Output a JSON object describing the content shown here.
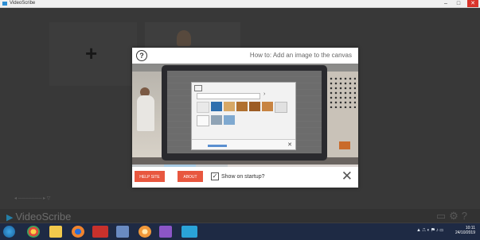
{
  "window": {
    "title": "VideoScribe",
    "minimize": "–",
    "maximize": "□",
    "close": "✕"
  },
  "background": {
    "new_canvas_symbol": "+",
    "logo_text": "VideoScribe",
    "logo_icon": "play-triangle-icon",
    "bottom_icons": [
      "folder-icon",
      "gear-icon",
      "help-icon"
    ]
  },
  "modal": {
    "help_icon": "?",
    "title": "How to: Add an image to the canvas",
    "buttons": {
      "help": "HELP SITE",
      "about": "ABOUT"
    },
    "startup_label": "Show on startup?",
    "startup_checked": true,
    "check_mark": "✓",
    "close_symbol": "✕",
    "timeline_marker": "◆"
  },
  "colors": {
    "accent": "#e8573f",
    "taskbar": "#1e2a44",
    "modal_bg": "#ffffff"
  },
  "taskbar": {
    "apps": [
      "windows-start-icon",
      "chrome-icon",
      "file-explorer-icon",
      "firefox-icon",
      "autodesk-icon",
      "calendar-icon",
      "origin-icon",
      "g-icon",
      "videoscribe-icon"
    ],
    "time": "10:11",
    "date": "24/10/2019"
  }
}
